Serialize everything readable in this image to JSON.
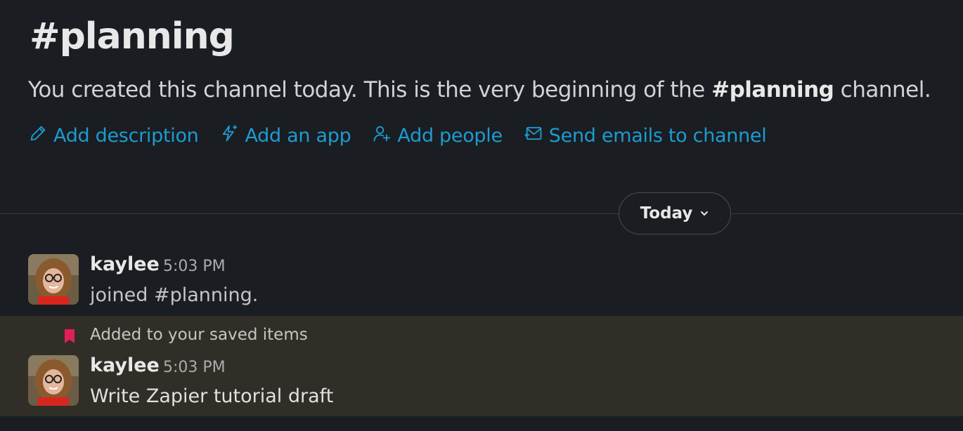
{
  "channel": {
    "title": "#planning",
    "intro_prefix": "You created this channel today. This is the very beginning of the ",
    "intro_channel": "#planning",
    "intro_suffix": " channel."
  },
  "actions": [
    {
      "label": "Add description",
      "icon": "pencil-icon"
    },
    {
      "label": "Add an app",
      "icon": "lightning-icon"
    },
    {
      "label": "Add people",
      "icon": "add-person-icon"
    },
    {
      "label": "Send emails to channel",
      "icon": "email-icon"
    }
  ],
  "divider": {
    "label": "Today",
    "icon": "chevron-down-icon"
  },
  "messages": [
    {
      "author": "kaylee",
      "time": "5:03 PM",
      "text": "joined #planning."
    },
    {
      "author": "kaylee",
      "time": "5:03 PM",
      "text": "Write Zapier tutorial draft",
      "saved_note": "Added to your saved items"
    }
  ],
  "colors": {
    "background": "#1a1d21",
    "link": "#1d9bd1",
    "saved_highlight": "#302e27",
    "bookmark": "#e01e5a"
  }
}
